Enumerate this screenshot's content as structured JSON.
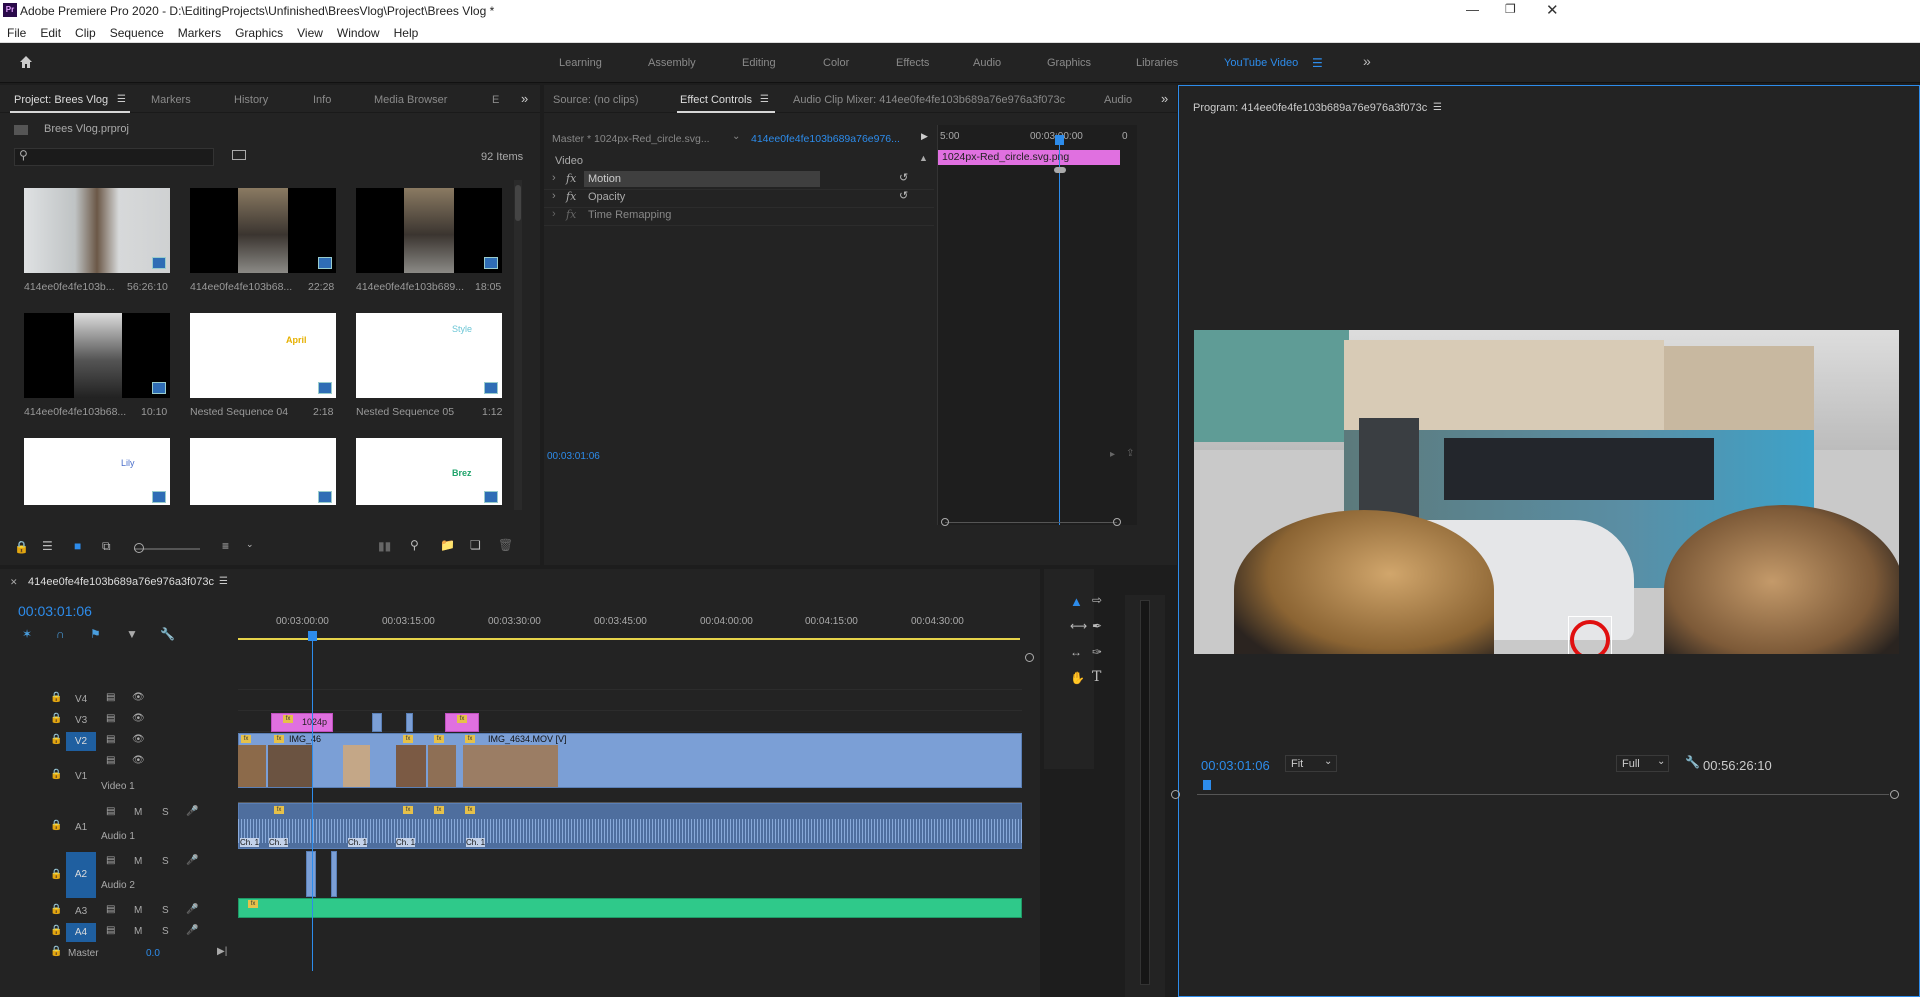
{
  "app": {
    "title": "Adobe Premiere Pro 2020 - D:\\EditingProjects\\Unfinished\\BreesVlog\\Project\\Brees Vlog *",
    "logo": "Pr"
  },
  "menu": [
    "File",
    "Edit",
    "Clip",
    "Sequence",
    "Markers",
    "Graphics",
    "View",
    "Window",
    "Help"
  ],
  "workspaces": [
    "Learning",
    "Assembly",
    "Editing",
    "Color",
    "Effects",
    "Audio",
    "Graphics",
    "Libraries",
    "YouTube Video"
  ],
  "project_panel": {
    "tabs": [
      "Project: Brees Vlog",
      "Markers",
      "History",
      "Info",
      "Media Browser",
      "E"
    ],
    "project_file": "Brees Vlog.prproj",
    "item_count": "92 Items",
    "items": [
      {
        "name": "414ee0fe4fe103b...",
        "duration": "56:26:10",
        "kind": "video"
      },
      {
        "name": "414ee0fe4fe103b68...",
        "duration": "22:28",
        "kind": "video"
      },
      {
        "name": "414ee0fe4fe103b689...",
        "duration": "18:05",
        "kind": "video"
      },
      {
        "name": "414ee0fe4fe103b68...",
        "duration": "10:10",
        "kind": "video"
      },
      {
        "name": "Nested Sequence 04",
        "duration": "2:18",
        "kind": "text",
        "word": "April",
        "color": "#e6b000"
      },
      {
        "name": "Nested Sequence 05",
        "duration": "1:12",
        "kind": "text",
        "word": "Style",
        "color": "#6cc6d6"
      },
      {
        "name": "",
        "duration": "",
        "kind": "text",
        "word": "Lily",
        "color": "#4a6ec9"
      },
      {
        "name": "",
        "duration": "",
        "kind": "blank",
        "word": "",
        "color": "#fff"
      },
      {
        "name": "",
        "duration": "",
        "kind": "text",
        "word": "Brez",
        "color": "#1fa36b"
      }
    ]
  },
  "effect_controls": {
    "tabs": [
      "Source: (no clips)",
      "Effect Controls",
      "Audio Clip Mixer: 414ee0fe4fe103b689a76e976a3f073c",
      "Audio"
    ],
    "master_label": "Master * 1024px-Red_circle.svg...",
    "sequence_label": "414ee0fe4fe103b689a76e976...",
    "ruler": [
      "5:00",
      "00:03:00:00",
      "0"
    ],
    "clip_label": "1024px-Red_circle.svg.png",
    "section": "Video",
    "effects": [
      "Motion",
      "Opacity",
      "Time Remapping"
    ],
    "timecode": "00:03:01:06"
  },
  "program_monitor": {
    "title": "Program: 414ee0fe4fe103b689a76e976a3f073c",
    "timecode": "00:03:01:06",
    "zoom": "Fit",
    "quality": "Full",
    "duration": "00:56:26:10"
  },
  "timeline": {
    "sequence_name": "414ee0fe4fe103b689a76e976a3f073c",
    "timecode": "00:03:01:06",
    "ruler": [
      "00:03:00:00",
      "00:03:15:00",
      "00:03:30:00",
      "00:03:45:00",
      "00:04:00:00",
      "00:04:15:00",
      "00:04:30:00"
    ],
    "tracks": [
      {
        "id": "V4",
        "name": ""
      },
      {
        "id": "V3",
        "name": ""
      },
      {
        "id": "V2",
        "name": ""
      },
      {
        "id": "V1",
        "name": "Video 1"
      },
      {
        "id": "A1",
        "name": "Audio 1"
      },
      {
        "id": "A2",
        "name": "Audio 2"
      },
      {
        "id": "A3",
        "name": ""
      },
      {
        "id": "A4",
        "name": ""
      }
    ],
    "master_label": "Master",
    "master_value": "0.0",
    "clips": {
      "v2_label": "1024p",
      "v1_label_a": "IMG_46",
      "v1_label_b": "IMG_4634.MOV [V]",
      "audio_ch": "Ch. 1"
    },
    "colors": {
      "accent": "#2d8ceb",
      "video_clip": "#7b9fd6",
      "graphic_clip": "#e070e0",
      "audio_green": "#2fc98a"
    }
  },
  "icons": {
    "home": "home-icon",
    "menu": "hamburger-icon"
  }
}
